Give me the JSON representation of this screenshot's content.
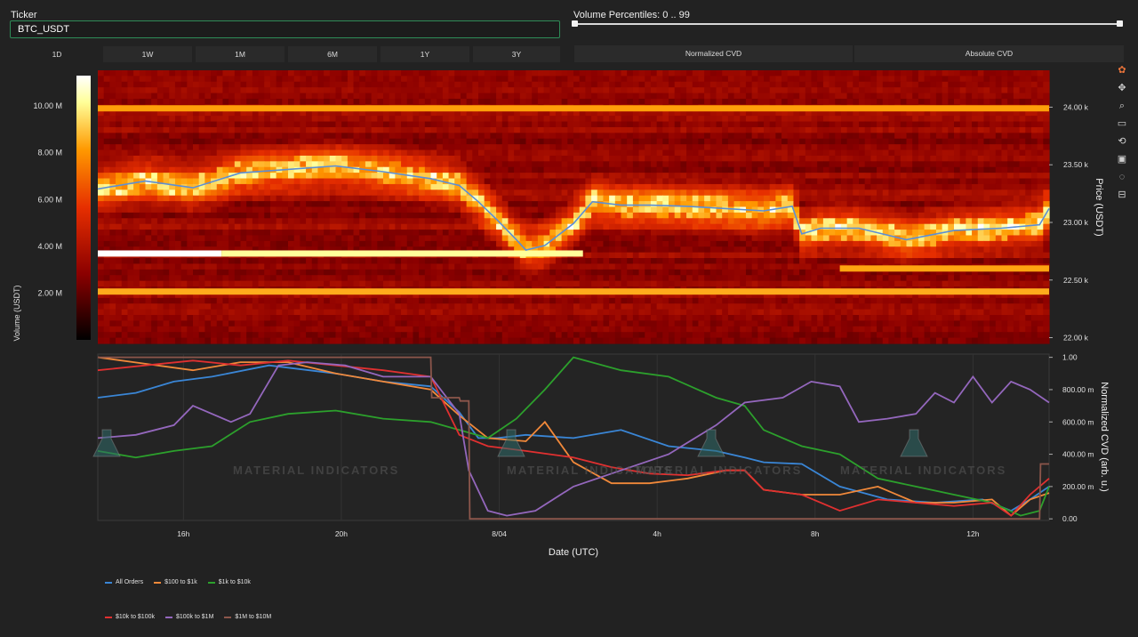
{
  "ticker": {
    "label": "Ticker",
    "value": "BTC_USDT"
  },
  "slider": {
    "label": "Volume Percentiles: 0 .. 99",
    "min": 0,
    "max": 99
  },
  "timeframes": [
    "1D",
    "1W",
    "1M",
    "6M",
    "1Y",
    "3Y"
  ],
  "active_timeframe": "1D",
  "modes": [
    "Normalized CVD",
    "Absolute CVD"
  ],
  "watermark": "MATERIAL INDICATORS",
  "modebar_icons": [
    "plotly-logo-icon",
    "pan-icon",
    "zoom-icon",
    "box-select-icon",
    "reset-axes-icon",
    "download-icon",
    "autoscale-icon",
    "spike-lines-icon"
  ],
  "chart_data": [
    {
      "type": "heatmap",
      "colorbar": {
        "label": "Volume (USDT)",
        "ticks": [
          "2.00 M",
          "4.00 M",
          "6.00 M",
          "8.00 M",
          "10.00 M"
        ],
        "tick_values": [
          2,
          4,
          6,
          8,
          10
        ],
        "range": [
          0,
          11.3
        ],
        "colors": [
          "#000000",
          "#8b0000",
          "#e62e00",
          "#ff9900",
          "#ffff99",
          "#ffffff"
        ]
      },
      "y_axis": {
        "title": "Price (USDT)",
        "ticks": [
          "22.00 k",
          "22.50 k",
          "23.00 k",
          "23.50 k",
          "24.00 k"
        ],
        "tick_values": [
          22000,
          22500,
          23000,
          23500,
          24000
        ],
        "range": [
          21950,
          24320
        ]
      },
      "strong_levels": [
        {
          "price": 22730,
          "t_start": 0,
          "t_end": 0.13,
          "level": 1.0
        },
        {
          "price": 22730,
          "t_start": 0.13,
          "t_end": 0.51,
          "level": 0.78
        },
        {
          "price": 22400,
          "t_start": 0,
          "t_end": 1,
          "level": 0.45
        },
        {
          "price": 23990,
          "t_start": 0,
          "t_end": 1,
          "level": 0.4
        },
        {
          "price": 22600,
          "t_start": 0.78,
          "t_end": 1,
          "level": 0.42
        }
      ],
      "price_series": {
        "name": "Price",
        "color": "#5b8fd6",
        "x": [
          0,
          0.05,
          0.1,
          0.15,
          0.2,
          0.25,
          0.3,
          0.35,
          0.38,
          0.4,
          0.42,
          0.44,
          0.45,
          0.47,
          0.5,
          0.52,
          0.55,
          0.58,
          0.62,
          0.66,
          0.7,
          0.73,
          0.74,
          0.76,
          0.8,
          0.85,
          0.9,
          0.95,
          0.99,
          1.0
        ],
        "y": [
          23290,
          23360,
          23300,
          23430,
          23460,
          23490,
          23440,
          23380,
          23320,
          23180,
          23020,
          22850,
          22760,
          22800,
          22990,
          23180,
          23150,
          23150,
          23140,
          23120,
          23100,
          23140,
          22900,
          22950,
          22950,
          22850,
          22930,
          22950,
          22980,
          23120
        ]
      }
    },
    {
      "type": "line",
      "x_label": "Date (UTC)",
      "x_ticks": [
        "16h",
        "20h",
        "8/04",
        "4h",
        "8h",
        "12h"
      ],
      "x_tick_positions": [
        0.09,
        0.256,
        0.422,
        0.588,
        0.754,
        0.92
      ],
      "y_label": "Normalized CVD (arb. u.)",
      "y_ticks": [
        "0.00",
        "200.00 m",
        "400.00 m",
        "600.00 m",
        "800.00 m",
        "1.00"
      ],
      "y_tick_values": [
        0,
        0.2,
        0.4,
        0.6,
        0.8,
        1.0
      ],
      "ylim": [
        -0.01,
        1.02
      ],
      "legend_placement": "bottom-left",
      "series": [
        {
          "name": "All Orders",
          "color": "#3a86d6",
          "x": [
            0,
            0.04,
            0.08,
            0.12,
            0.18,
            0.25,
            0.3,
            0.35,
            0.38,
            0.4,
            0.42,
            0.45,
            0.5,
            0.55,
            0.6,
            0.65,
            0.68,
            0.7,
            0.74,
            0.78,
            0.83,
            0.88,
            0.93,
            0.96,
            0.98,
            1.0
          ],
          "y": [
            0.75,
            0.78,
            0.85,
            0.88,
            0.95,
            0.9,
            0.85,
            0.82,
            0.66,
            0.5,
            0.5,
            0.52,
            0.5,
            0.55,
            0.45,
            0.42,
            0.38,
            0.35,
            0.34,
            0.2,
            0.12,
            0.1,
            0.12,
            0.05,
            0.12,
            0.2
          ]
        },
        {
          "name": "$100 to $1k",
          "color": "#f2893a",
          "x": [
            0,
            0.05,
            0.1,
            0.15,
            0.2,
            0.25,
            0.3,
            0.35,
            0.38,
            0.41,
            0.45,
            0.47,
            0.5,
            0.54,
            0.58,
            0.62,
            0.66,
            0.68,
            0.7,
            0.74,
            0.78,
            0.82,
            0.86,
            0.9,
            0.94,
            0.96,
            0.98,
            1.0
          ],
          "y": [
            1.0,
            0.96,
            0.92,
            0.97,
            0.97,
            0.9,
            0.85,
            0.8,
            0.64,
            0.5,
            0.48,
            0.6,
            0.35,
            0.22,
            0.22,
            0.25,
            0.3,
            0.3,
            0.18,
            0.15,
            0.15,
            0.2,
            0.1,
            0.1,
            0.12,
            0.02,
            0.12,
            0.16
          ]
        },
        {
          "name": "$1k to $10k",
          "color": "#2ca02c",
          "x": [
            0,
            0.04,
            0.08,
            0.12,
            0.16,
            0.2,
            0.25,
            0.3,
            0.35,
            0.38,
            0.41,
            0.44,
            0.47,
            0.5,
            0.55,
            0.6,
            0.65,
            0.68,
            0.7,
            0.74,
            0.78,
            0.82,
            0.86,
            0.9,
            0.94,
            0.97,
            0.99,
            1.0
          ],
          "y": [
            0.42,
            0.38,
            0.42,
            0.45,
            0.6,
            0.65,
            0.67,
            0.62,
            0.6,
            0.55,
            0.5,
            0.62,
            0.8,
            1.0,
            0.92,
            0.88,
            0.75,
            0.7,
            0.55,
            0.45,
            0.4,
            0.25,
            0.2,
            0.15,
            0.1,
            0.02,
            0.05,
            0.2
          ]
        },
        {
          "name": "$10k to $100k",
          "color": "#e03030",
          "x": [
            0,
            0.05,
            0.1,
            0.15,
            0.2,
            0.25,
            0.3,
            0.35,
            0.38,
            0.41,
            0.45,
            0.5,
            0.54,
            0.58,
            0.62,
            0.66,
            0.68,
            0.7,
            0.74,
            0.78,
            0.82,
            0.86,
            0.9,
            0.94,
            0.96,
            0.98,
            1.0
          ],
          "y": [
            0.92,
            0.95,
            0.98,
            0.95,
            0.98,
            0.95,
            0.92,
            0.88,
            0.52,
            0.45,
            0.42,
            0.38,
            0.32,
            0.28,
            0.27,
            0.3,
            0.3,
            0.18,
            0.15,
            0.05,
            0.12,
            0.1,
            0.08,
            0.1,
            0.02,
            0.15,
            0.25
          ]
        },
        {
          "name": "$100k to $1M",
          "color": "#9467bd",
          "x": [
            0,
            0.04,
            0.08,
            0.1,
            0.14,
            0.16,
            0.19,
            0.22,
            0.26,
            0.3,
            0.35,
            0.38,
            0.39,
            0.41,
            0.43,
            0.46,
            0.5,
            0.55,
            0.6,
            0.65,
            0.68,
            0.72,
            0.75,
            0.78,
            0.8,
            0.83,
            0.86,
            0.88,
            0.9,
            0.92,
            0.94,
            0.96,
            0.98,
            1.0
          ],
          "y": [
            0.5,
            0.52,
            0.58,
            0.7,
            0.6,
            0.65,
            0.95,
            0.97,
            0.95,
            0.88,
            0.88,
            0.65,
            0.3,
            0.05,
            0.02,
            0.05,
            0.2,
            0.3,
            0.4,
            0.58,
            0.72,
            0.75,
            0.85,
            0.82,
            0.6,
            0.62,
            0.65,
            0.78,
            0.72,
            0.88,
            0.72,
            0.85,
            0.8,
            0.72
          ]
        },
        {
          "name": "$1M to $10M",
          "color": "#8c564b",
          "x": [
            0,
            0.35,
            0.351,
            0.38,
            0.381,
            0.39,
            0.391,
            0.41,
            0.411,
            0.99,
            0.991,
            1.0
          ],
          "y": [
            1.0,
            1.0,
            0.75,
            0.75,
            0.73,
            0.73,
            0.0,
            0.0,
            0.0,
            0.0,
            0.34,
            0.34
          ]
        }
      ]
    }
  ]
}
